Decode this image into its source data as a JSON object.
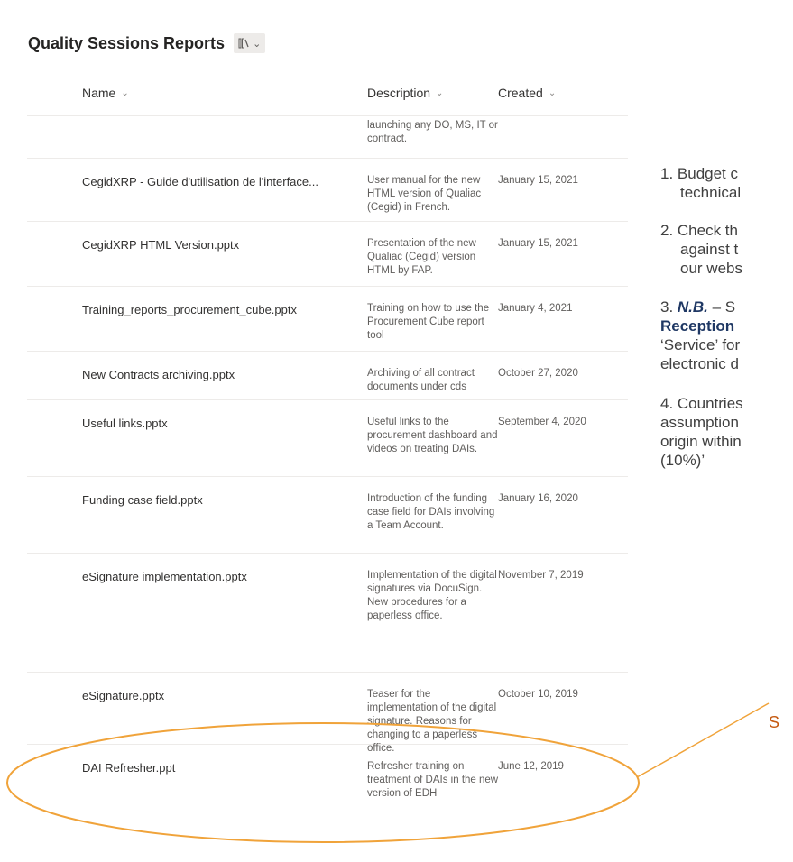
{
  "library": {
    "title": "Quality Sessions Reports",
    "view_icon": "library-view-icon",
    "view_chevron": "⌄"
  },
  "columns": {
    "name": "Name",
    "description": "Description",
    "created": "Created",
    "chevron": "⌄"
  },
  "rows": [
    {
      "name": "",
      "description": "launching any DO, MS, IT or contract.",
      "created": ""
    },
    {
      "name": "CegidXRP - Guide d'utilisation de l'interface...",
      "description": "User manual for the new HTML version of Qualiac (Cegid) in French.",
      "created": "January 15, 2021"
    },
    {
      "name": "CegidXRP HTML Version.pptx",
      "description": "Presentation of the new Qualiac (Cegid) version HTML by FAP.",
      "created": "January 15, 2021"
    },
    {
      "name": "Training_reports_procurement_cube.pptx",
      "description": "Training on how to use the Procurement Cube report tool",
      "created": "January 4, 2021"
    },
    {
      "name": "New Contracts archiving.pptx",
      "description": "Archiving of all contract documents under cds",
      "created": "October 27, 2020"
    },
    {
      "name": "Useful links.pptx",
      "description": "Useful links to the procurement dashboard and videos on treating DAIs.",
      "created": "September 4, 2020"
    },
    {
      "name": "Funding case field.pptx",
      "description": "Introduction of the funding case field for DAIs involving a Team Account.",
      "created": "January 16, 2020"
    },
    {
      "name": "eSignature implementation.pptx",
      "description": "Implementation of the digital signatures via DocuSign. New procedures for a paperless office.",
      "created": "November 7, 2019"
    },
    {
      "name": "eSignature.pptx",
      "description": "Teaser for the implementation of the digital signature. Reasons for changing to a paperless office.",
      "created": "October 10, 2019"
    },
    {
      "name": "DAI Refresher.ppt",
      "description": "Refresher training on treatment of DAIs in the new version of EDH",
      "created": "June 12, 2019"
    }
  ],
  "slide_text": {
    "item1_line1": "1.  Budget c",
    "item1_line2": "technical",
    "item2_line1": "2.  Check th",
    "item2_line2": "against t",
    "item2_line3": "our webs",
    "item3_num": "3. ",
    "item3_nb": "N.B.",
    "item3_dash": " – S",
    "item3_line2": "Reception",
    "item3_line3": "‘Service’ for",
    "item3_line4": "electronic d",
    "item4_line1": "4. Countries",
    "item4_line2": "assumption",
    "item4_line3": "origin within",
    "item4_line4": "(10%)’",
    "partial_s": "S"
  },
  "colors": {
    "highlight_ellipse": "#f0a33a",
    "navy_text": "#1f3864"
  }
}
